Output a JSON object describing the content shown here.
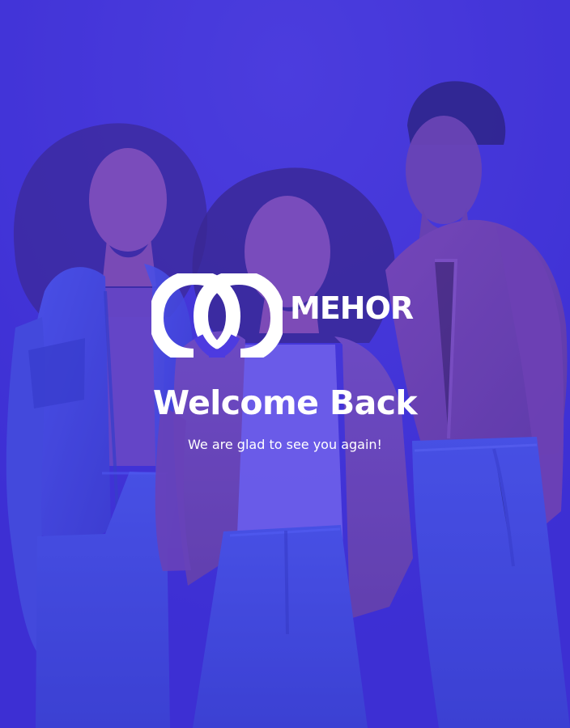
{
  "brand": {
    "name": "MEHOR",
    "logo_icon": "interlocked-rings-logo-icon"
  },
  "hero": {
    "title": "Welcome Back",
    "subtitle": "We are glad to see you again!",
    "image_name": "three-women-smiling-photo"
  },
  "colors": {
    "overlay": "#4536d8",
    "text": "#ffffff",
    "denim": "#4f5ee8",
    "jacket_tan": "#8a59b8",
    "sweater_orange": "#8e4ea9"
  }
}
